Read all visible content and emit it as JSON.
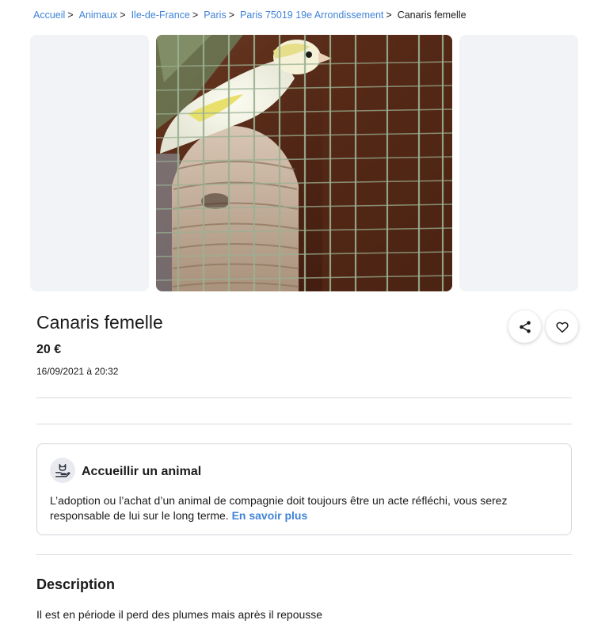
{
  "breadcrumb": {
    "items": [
      "Accueil",
      "Animaux",
      "Ile-de-France",
      "Paris",
      "Paris 75019 19e Arrondissement"
    ],
    "separator": ">",
    "current": "Canaris femelle"
  },
  "gallery": {
    "main_image": "photo of a white and yellow canary perched on a wicker nest inside a cage"
  },
  "listing": {
    "title": "Canaris femelle",
    "price": "20 €",
    "date": "16/09/2021 à 20:32"
  },
  "actions": {
    "share_icon": "share-icon",
    "favorite_icon": "heart-icon"
  },
  "info_card": {
    "icon": "pet-hand-icon",
    "title": "Accueillir un animal",
    "text": "L’adoption ou l’achat d’un animal de compagnie doit toujours être un acte réfléchi, vous serez responsable de lui sur le long terme.",
    "link": "En savoir plus"
  },
  "description": {
    "heading": "Description",
    "text": "Il est en période il perd des plumes mais après il repousse"
  },
  "colors": {
    "link": "#4183d7",
    "text": "#1a1a1a",
    "placeholder_bg": "#f2f3f7",
    "divider": "#dadce2"
  }
}
